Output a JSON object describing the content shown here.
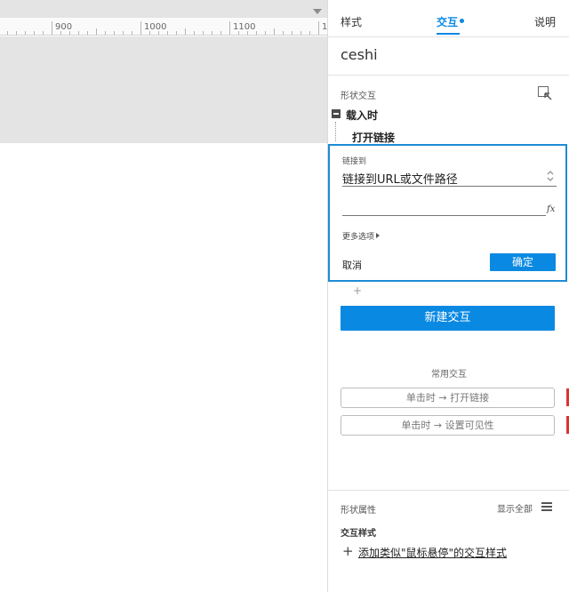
{
  "canvas": {
    "ruler_labels": [
      "900",
      "1000",
      "1100",
      "1"
    ]
  },
  "panel": {
    "tabs": [
      {
        "label": "样式"
      },
      {
        "label": "交互"
      },
      {
        "label": "说明"
      }
    ],
    "element_name": "ceshi",
    "shape_interactions_label": "形状交互",
    "event_label": "载入时",
    "action_label": "打开链接",
    "editor": {
      "link_to_label": "链接到",
      "link_target_value": "链接到URL或文件路径",
      "url_value": "",
      "fx_label": "fx",
      "more_options_label": "更多选项",
      "cancel_label": "取消",
      "ok_label": "确定"
    },
    "add_case_symbol": "+",
    "new_interaction_label": "新建交互",
    "common_interactions_label": "常用交互",
    "common_interactions": [
      {
        "label": "单击时 → 打开链接"
      },
      {
        "label": "单击时 → 设置可见性"
      }
    ],
    "shape_properties_label": "形状属性",
    "show_all_label": "显示全部",
    "interaction_styles_label": "交互样式",
    "add_style_link": "添加类似\"鼠标悬停\"的交互样式"
  },
  "colors": {
    "accent": "#0a89e3",
    "editor_border": "#1e8bd6",
    "canvas_gray": "#e4e4e4"
  }
}
